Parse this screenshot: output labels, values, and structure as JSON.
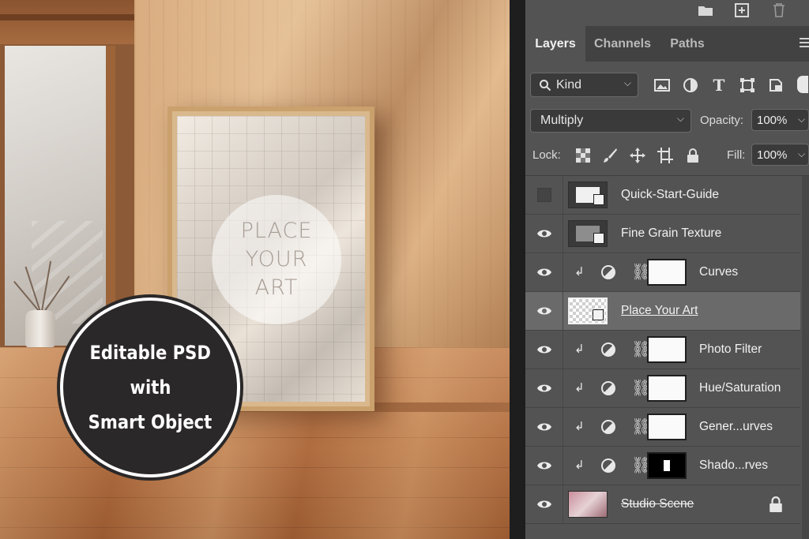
{
  "scene": {
    "art_text": [
      "PLACE",
      "YOUR",
      "ART"
    ],
    "badge_text": [
      "Editable PSD",
      "with",
      "Smart Object"
    ]
  },
  "panel": {
    "top_icons": [
      "folder-icon",
      "new-layer-icon",
      "trash-icon"
    ],
    "tabs": [
      {
        "label": "Layers",
        "active": true
      },
      {
        "label": "Channels",
        "active": false
      },
      {
        "label": "Paths",
        "active": false
      }
    ],
    "filter": {
      "kind_label": "Kind",
      "icons": [
        "image-filter-icon",
        "adjustment-filter-icon",
        "type-filter-icon",
        "shape-filter-icon",
        "smart-object-filter-icon"
      ]
    },
    "blend_mode": "Multiply",
    "opacity_label": "Opacity:",
    "opacity_value": "100%",
    "lock_label": "Lock:",
    "fill_label": "Fill:",
    "fill_value": "100%",
    "layers": [
      {
        "name": "Quick-Start-Guide",
        "visible": false,
        "type": "smart"
      },
      {
        "name": "Fine Grain Texture",
        "visible": true,
        "type": "smart"
      },
      {
        "name": "Curves",
        "visible": true,
        "type": "adjustment",
        "clipped": true
      },
      {
        "name": "Place Your Art",
        "visible": true,
        "type": "smart",
        "selected": true
      },
      {
        "name": "Photo Filter",
        "visible": true,
        "type": "adjustment",
        "clipped": true
      },
      {
        "name": "Hue/Saturation",
        "visible": true,
        "type": "adjustment",
        "clipped": true
      },
      {
        "name": "Gener...urves",
        "visible": true,
        "type": "adjustment",
        "clipped": true
      },
      {
        "name": "Shado...rves",
        "visible": true,
        "type": "adjustment",
        "clipped": true,
        "dark_mask": true
      },
      {
        "name": "Studio Scene",
        "visible": true,
        "type": "image",
        "locked": true
      }
    ]
  }
}
